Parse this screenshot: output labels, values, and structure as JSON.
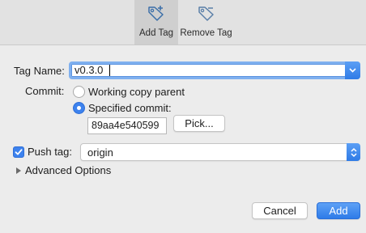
{
  "toolbar": {
    "add_tag_label": "Add Tag",
    "remove_tag_label": "Remove Tag",
    "active_tool": "add-tag"
  },
  "form": {
    "tag_name_label": "Tag Name:",
    "tag_name_value": "v0.3.0",
    "commit_label": "Commit:",
    "commit_options": [
      {
        "label": "Working copy parent",
        "selected": false
      },
      {
        "label": "Specified commit:",
        "selected": true
      }
    ],
    "commit_hash_value": "89aa4e540599",
    "pick_button_label": "Pick...",
    "push_tag_label": "Push tag:",
    "push_tag_checked": true,
    "remote_value": "origin",
    "advanced_options_label": "Advanced Options"
  },
  "footer": {
    "cancel_label": "Cancel",
    "add_label": "Add"
  },
  "colors": {
    "accent": "#3d82ee",
    "window_bg": "#ececec",
    "toolbar_bg": "#e2e2e2",
    "active_tool_bg": "#cfcfcf"
  },
  "icons": {
    "add_tag": "tag-plus-icon",
    "remove_tag": "tag-minus-icon",
    "dropdown": "chevron-down-icon",
    "stepper": "up-down-arrows-icon",
    "disclosure": "disclosure-triangle-icon",
    "checkmark": "checkmark-icon"
  }
}
